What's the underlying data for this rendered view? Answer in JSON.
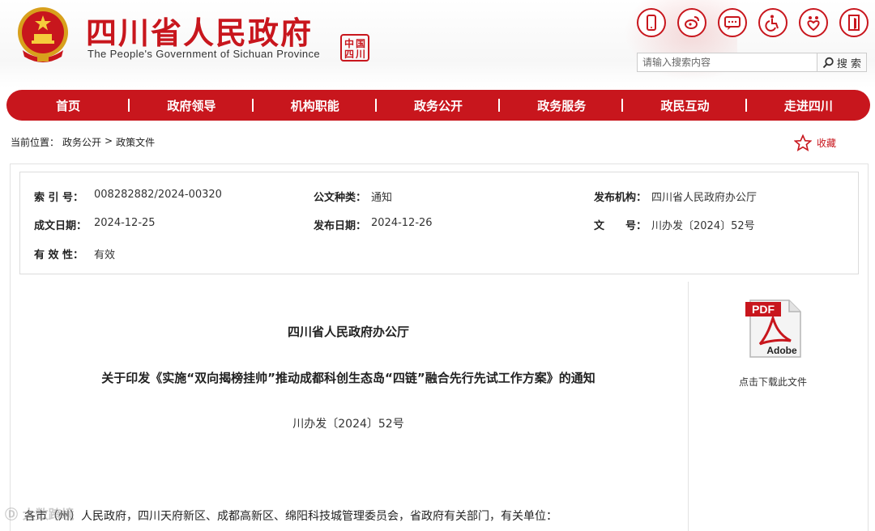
{
  "header": {
    "title": "四川省人民政府",
    "subtitle": "The People's Government of Sichuan Province",
    "seal_text": "中国四川",
    "quick_icons": [
      "mobile-icon",
      "weibo-icon",
      "wechat-icon",
      "accessibility-icon",
      "elder-care-icon",
      "exit-icon"
    ],
    "search": {
      "placeholder": "请输入搜索内容",
      "button_label": "搜 索"
    }
  },
  "nav": {
    "items": [
      "首页",
      "政府领导",
      "机构职能",
      "政务公开",
      "政务服务",
      "政民互动",
      "走进四川"
    ]
  },
  "breadcrumb": {
    "prefix": "当前位置：",
    "items": [
      "政务公开",
      "政策文件"
    ],
    "separator": ">"
  },
  "favorite": {
    "label": "收藏"
  },
  "meta": {
    "index_label": "索 引 号：",
    "index_value": "008282882/2024-00320",
    "type_label": "公文种类：",
    "type_value": "通知",
    "publisher_label": "发布机构：",
    "publisher_value": "四川省人民政府办公厅",
    "written_label": "成文日期：",
    "written_value": "2024-12-25",
    "published_label": "发布日期：",
    "published_value": "2024-12-26",
    "docno_label": "文　　号：",
    "docno_value": "川办发〔2024〕52号",
    "validity_label": "有 效 性：",
    "validity_value": "有效"
  },
  "document": {
    "issuer": "四川省人民政府办公厅",
    "title": "关于印发《实施“双向揭榜挂帅”推动成都科创生态岛“四链”融合先行先试工作方案》的通知",
    "number": "川办发〔2024〕52号",
    "addressee": "各市（州）人民政府，四川天府新区、成都高新区、绵阳科技城管理委员会，省政府有关部门，有关单位："
  },
  "download": {
    "badge": "PDF",
    "brand": "Adobe",
    "caption": "点击下载此文件"
  },
  "watermark": "大数跨境",
  "colors": {
    "brand_red": "#c8161d",
    "border": "#dcdcdc"
  }
}
